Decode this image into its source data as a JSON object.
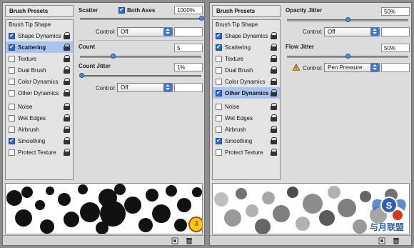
{
  "left_panel": {
    "presets_button": "Brush Presets",
    "tip_shape": "Brush Tip Shape",
    "items": [
      {
        "label": "Shape Dynamics",
        "checked": true,
        "active": false,
        "gap_before": false
      },
      {
        "label": "Scattering",
        "checked": true,
        "active": true,
        "gap_before": false
      },
      {
        "label": "Texture",
        "checked": false,
        "active": false,
        "gap_before": false
      },
      {
        "label": "Dual Brush",
        "checked": false,
        "active": false,
        "gap_before": false
      },
      {
        "label": "Color Dynamics",
        "checked": false,
        "active": false,
        "gap_before": false
      },
      {
        "label": "Other Dynamics",
        "checked": false,
        "active": false,
        "gap_before": false
      },
      {
        "label": "Noise",
        "checked": false,
        "active": false,
        "gap_before": true
      },
      {
        "label": "Wet Edges",
        "checked": false,
        "active": false,
        "gap_before": false
      },
      {
        "label": "Airbrush",
        "checked": false,
        "active": false,
        "gap_before": false
      },
      {
        "label": "Smoothing",
        "checked": true,
        "active": false,
        "gap_before": false
      },
      {
        "label": "Protect Texture",
        "checked": false,
        "active": false,
        "gap_before": false
      }
    ],
    "scatter": {
      "label": "Scatter",
      "both_axes": "Both Axes",
      "both_axes_checked": true,
      "value": "1000%",
      "level": 1.0
    },
    "control1": {
      "label": "Control:",
      "value": "Off",
      "field": ""
    },
    "count": {
      "label": "Count",
      "value": "5",
      "level": 0.27
    },
    "count_jitter": {
      "label": "Count Jitter",
      "value": "1%",
      "level": 0.01
    },
    "control2": {
      "label": "Control:",
      "value": "Off",
      "field": ""
    },
    "badge": "3"
  },
  "right_panel": {
    "presets_button": "Brush Presets",
    "tip_shape": "Brush Tip Shape",
    "items": [
      {
        "label": "Shape Dynamics",
        "checked": true,
        "active": false,
        "gap_before": false
      },
      {
        "label": "Scattering",
        "checked": true,
        "active": false,
        "gap_before": false
      },
      {
        "label": "Texture",
        "checked": false,
        "active": false,
        "gap_before": false
      },
      {
        "label": "Dual Brush",
        "checked": false,
        "active": false,
        "gap_before": false
      },
      {
        "label": "Color Dynamics",
        "checked": false,
        "active": false,
        "gap_before": false
      },
      {
        "label": "Other Dynamics",
        "checked": true,
        "active": true,
        "gap_before": false
      },
      {
        "label": "Noise",
        "checked": false,
        "active": false,
        "gap_before": true
      },
      {
        "label": "Wet Edges",
        "checked": false,
        "active": false,
        "gap_before": false
      },
      {
        "label": "Airbrush",
        "checked": false,
        "active": false,
        "gap_before": false
      },
      {
        "label": "Smoothing",
        "checked": true,
        "active": false,
        "gap_before": false
      },
      {
        "label": "Protect Texture",
        "checked": false,
        "active": false,
        "gap_before": false
      }
    ],
    "opacity_jitter": {
      "label": "Opacity Jitter",
      "value": "50%",
      "level": 0.5
    },
    "control1": {
      "label": "Control:",
      "value": "Off",
      "field": ""
    },
    "flow_jitter": {
      "label": "Flow Jitter",
      "value": "50%",
      "level": 0.5
    },
    "control2": {
      "label": "Control:",
      "value": "Pen Pressure",
      "field": ""
    }
  },
  "watermark": "与月联盟",
  "colors": {
    "panel": "#dcdcdc",
    "active_row": "#a9c5ef",
    "accent": "#3b73d9",
    "badge": "#f0d000"
  }
}
